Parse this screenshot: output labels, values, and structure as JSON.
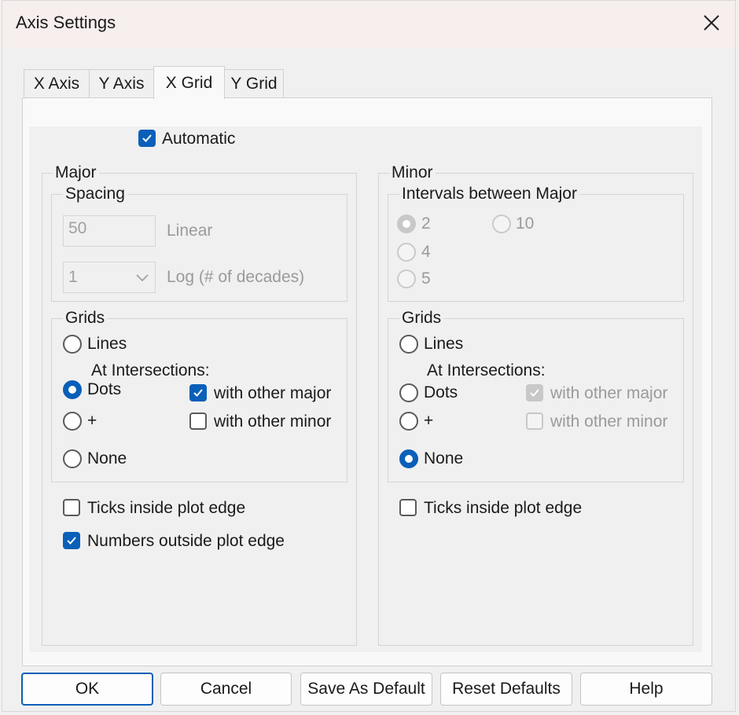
{
  "window": {
    "title": "Axis Settings"
  },
  "tabs": [
    "X Axis",
    "Y Axis",
    "X Grid",
    "Y Grid"
  ],
  "automatic_label": "Automatic",
  "major": {
    "title": "Major",
    "spacing": {
      "title": "Spacing",
      "linear_value": "50",
      "linear_label": "Linear",
      "log_value": "1",
      "log_label": "Log (# of decades)"
    },
    "grids": {
      "title": "Grids",
      "lines": "Lines",
      "at_intersections": "At Intersections:",
      "dots": "Dots",
      "plus": "+",
      "none": "None",
      "with_other_major": "with other major",
      "with_other_minor": "with other minor"
    },
    "ticks_inside": "Ticks inside plot edge",
    "numbers_outside": "Numbers outside plot edge"
  },
  "minor": {
    "title": "Minor",
    "intervals": {
      "title": "Intervals between Major",
      "opt_2": "2",
      "opt_4": "4",
      "opt_5": "5",
      "opt_10": "10"
    },
    "grids": {
      "title": "Grids",
      "lines": "Lines",
      "at_intersections": "At Intersections:",
      "dots": "Dots",
      "plus": "+",
      "none": "None",
      "with_other_major": "with other major",
      "with_other_minor": "with other minor"
    },
    "ticks_inside": "Ticks inside plot edge"
  },
  "buttons": {
    "ok": "OK",
    "cancel": "Cancel",
    "save_default": "Save As Default",
    "reset_defaults": "Reset Defaults",
    "help": "Help"
  },
  "colors": {
    "accent": "#0a5fb8",
    "disabled": "#9a9a9a"
  },
  "icons": {
    "close": "close-icon",
    "check": "checkmark-icon",
    "dropdown": "chevron-down-icon"
  }
}
